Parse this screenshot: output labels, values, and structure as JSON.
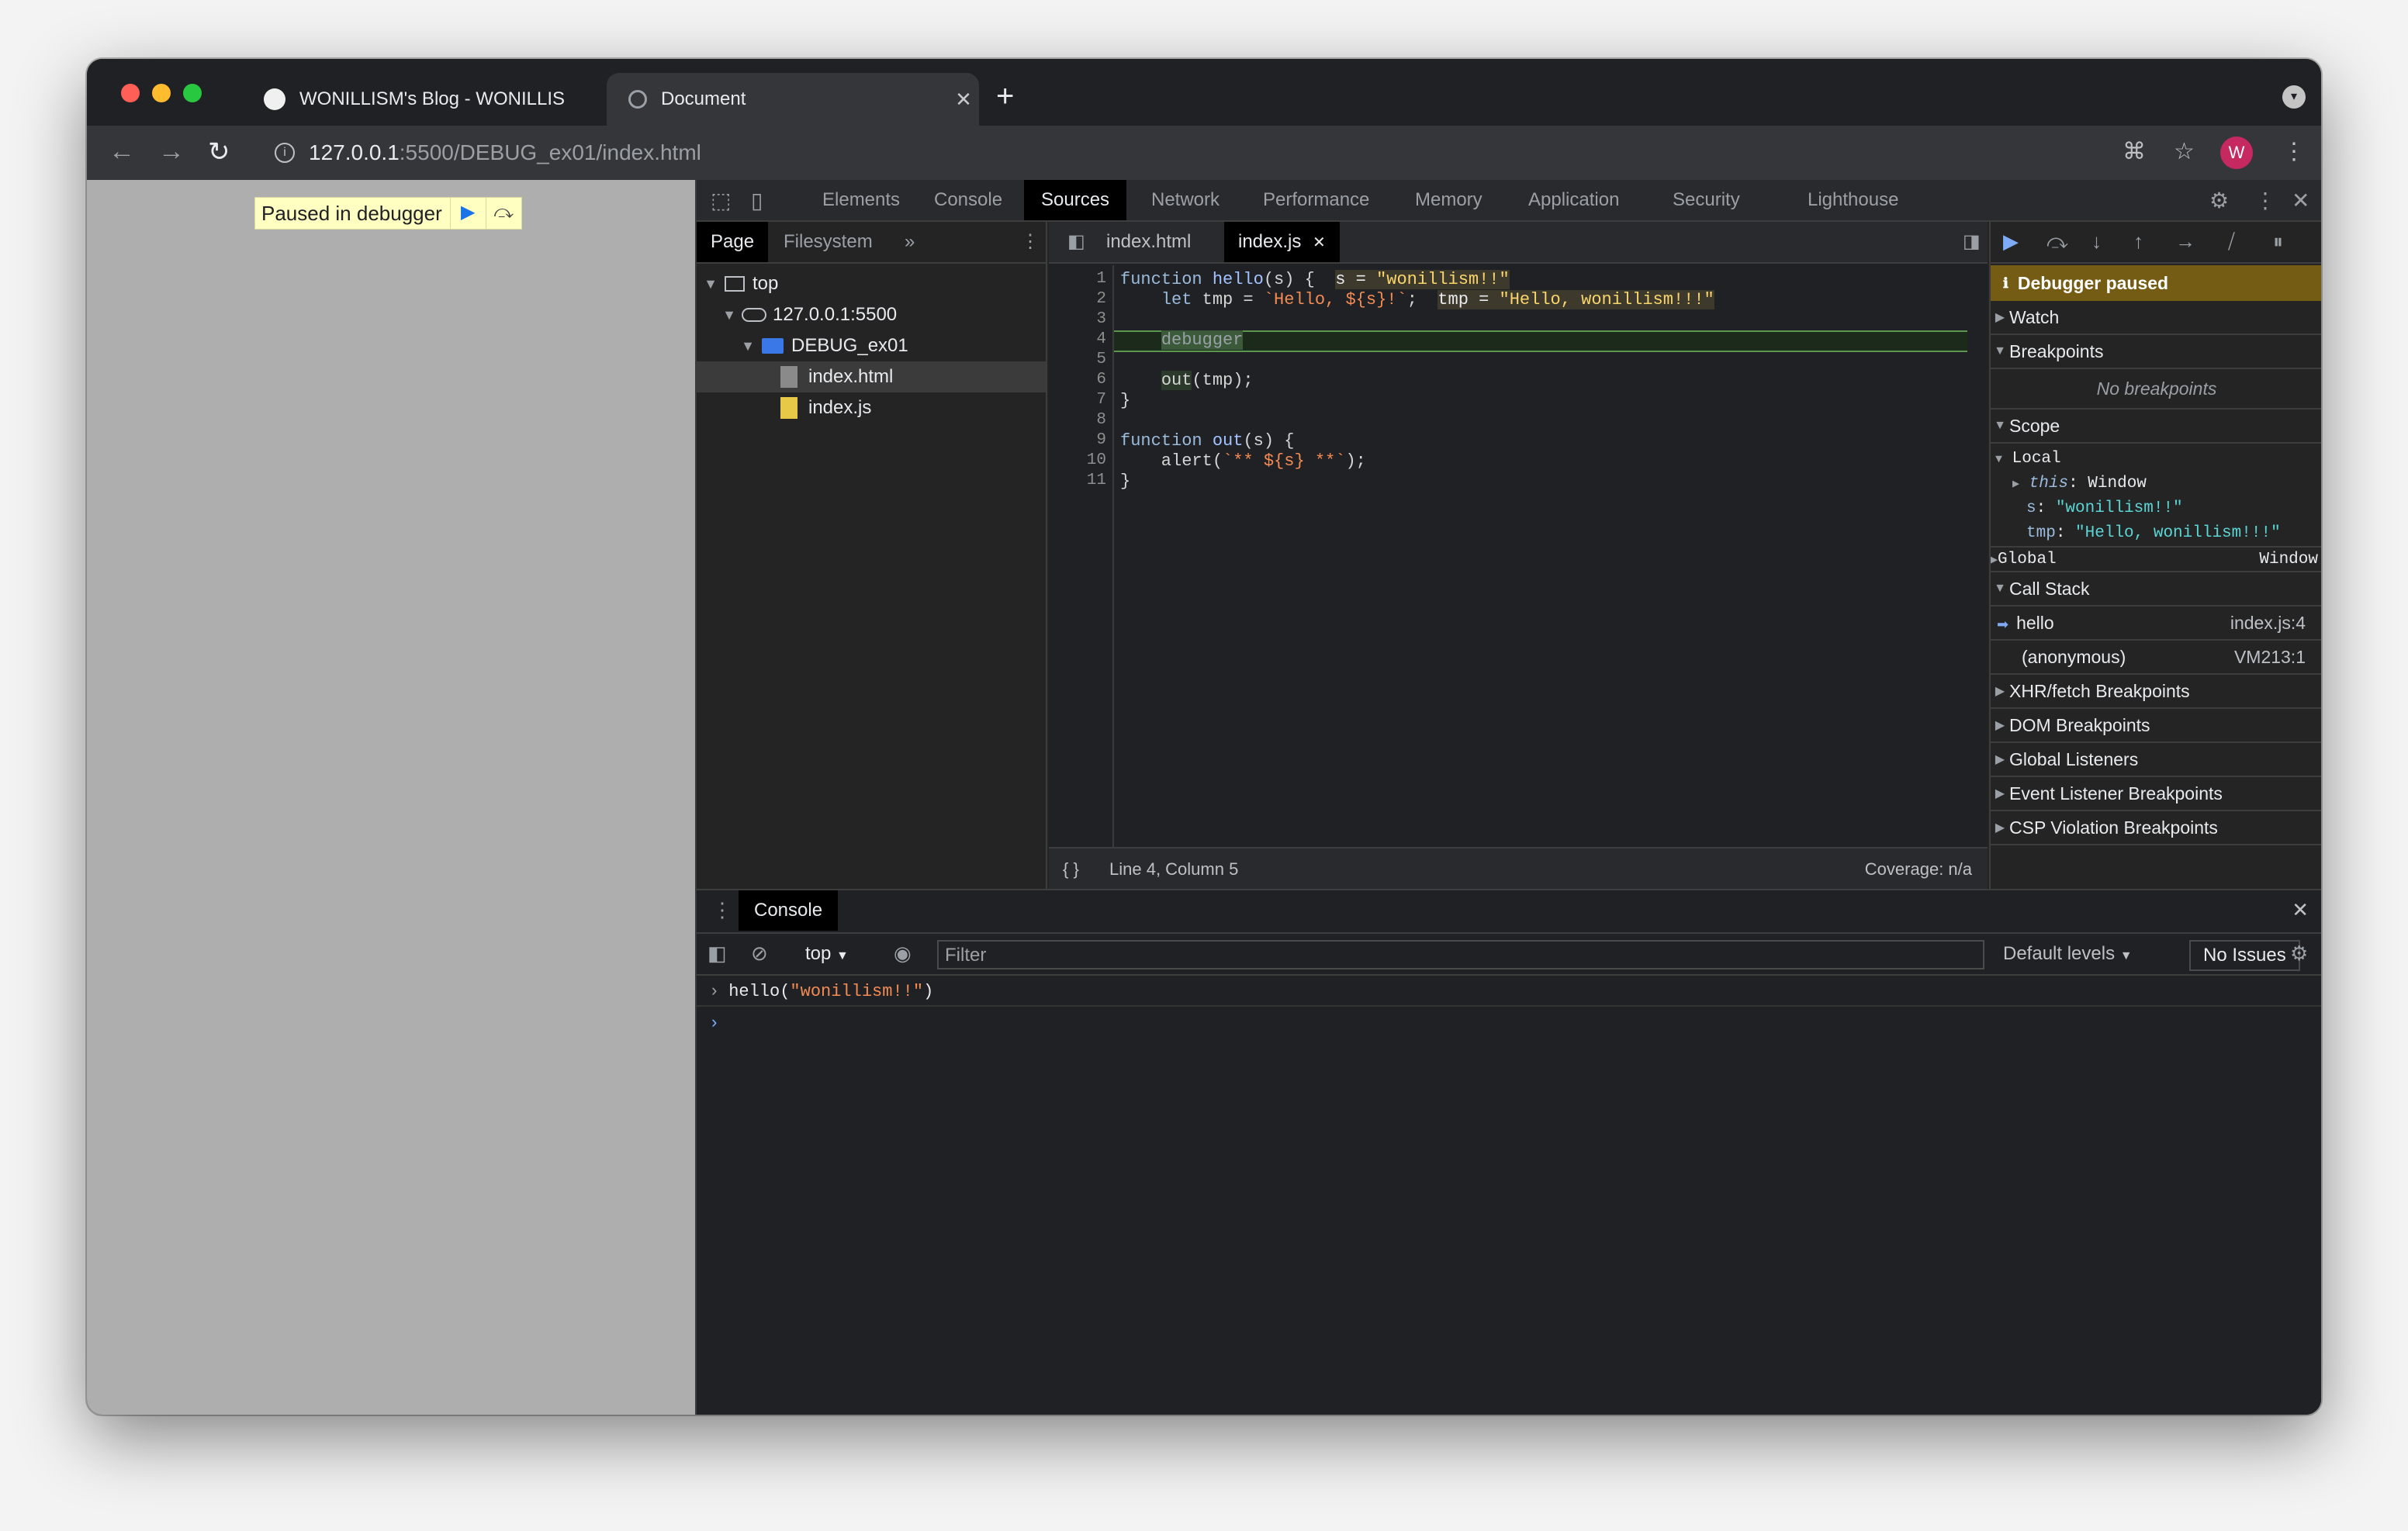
{
  "browser": {
    "tabs": [
      {
        "title": "WONILLISM's Blog - WONILLIS",
        "close": "✕"
      },
      {
        "title": "Document",
        "close": "✕"
      }
    ],
    "new_tab": "+",
    "url_host": "127.0.0.1",
    "url_path": ":5500/DEBUG_ex01/index.html",
    "avatar_letter": "W"
  },
  "page": {
    "paused_label": "Paused in debugger"
  },
  "devtools": {
    "panels": [
      "Elements",
      "Console",
      "Sources",
      "Network",
      "Performance",
      "Memory",
      "Application",
      "Security",
      "Lighthouse"
    ],
    "selected_panel": "Sources",
    "navigator": {
      "tabs": [
        "Page",
        "Filesystem"
      ],
      "more": "»",
      "tree": [
        {
          "label": "top",
          "level": 0
        },
        {
          "label": "127.0.0.1:5500",
          "level": 1
        },
        {
          "label": "DEBUG_ex01",
          "level": 2
        },
        {
          "label": "index.html",
          "level": 3
        },
        {
          "label": "index.js",
          "level": 3
        }
      ]
    },
    "editor": {
      "tabs": [
        "index.html",
        "index.js"
      ],
      "tab_close": "✕",
      "line_numbers": [
        "1",
        "2",
        "3",
        "4",
        "5",
        "6",
        "7",
        "8",
        "9",
        "10",
        "11"
      ],
      "status_left": "Line 4, Column 5",
      "status_right": "Coverage: n/a",
      "pretty_print": "{ }"
    },
    "sidebar": {
      "paused_banner": "Debugger paused",
      "watch": "Watch",
      "breakpoints": "Breakpoints",
      "no_breakpoints": "No breakpoints",
      "scope": "Scope",
      "local": "Local",
      "scope_this_key": "this",
      "scope_this_val": "Window",
      "scope_s_key": "s",
      "scope_s_val": "\"wonillism!!\"",
      "scope_tmp_key": "tmp",
      "scope_tmp_val": "\"Hello, wonillism!!!\"",
      "global": "Global",
      "global_val": "Window",
      "call_stack": "Call Stack",
      "frames": [
        {
          "name": "hello",
          "loc": "index.js:4"
        },
        {
          "name": "(anonymous)",
          "loc": "VM213:1"
        }
      ],
      "xhr": "XHR/fetch Breakpoints",
      "dom": "DOM Breakpoints",
      "global_listeners": "Global Listeners",
      "event_listener": "Event Listener Breakpoints",
      "csp": "CSP Violation Breakpoints"
    },
    "console": {
      "tab": "Console",
      "context": "top",
      "filter_placeholder": "Filter",
      "levels": "Default levels",
      "issues": "No Issues",
      "input_fn": "hello(",
      "input_arg": "\"wonillism!!\"",
      "input_end": ")"
    }
  }
}
